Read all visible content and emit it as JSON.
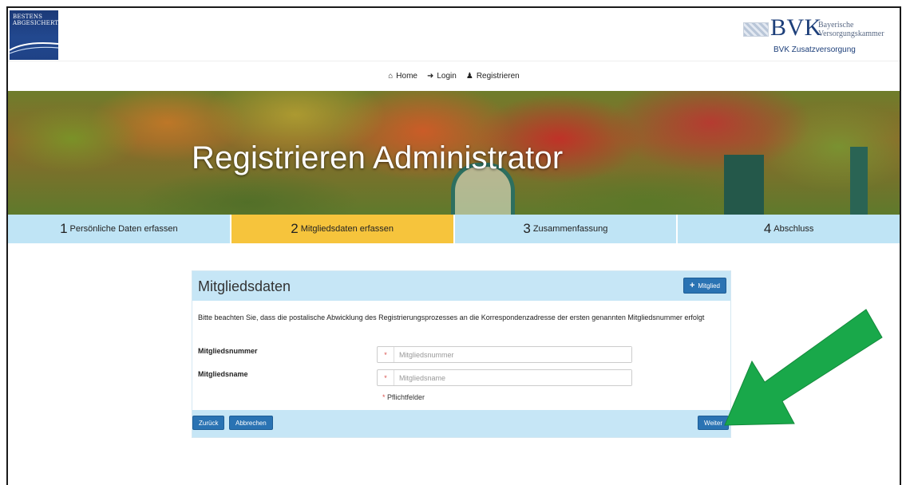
{
  "header": {
    "left_logo_text": [
      "BESTENS",
      "ABGESICHERT."
    ],
    "brand": "BVK",
    "brand_sub": [
      "Bayerische",
      "Versorgungskammer"
    ],
    "brand_tagline": "BVK Zusatzversorgung"
  },
  "nav": {
    "items": [
      {
        "icon": "home-icon",
        "label": "Home"
      },
      {
        "icon": "login-icon",
        "label": "Login"
      },
      {
        "icon": "user-plus-icon",
        "label": "Registrieren"
      }
    ]
  },
  "banner": {
    "title": "Registrieren Administrator"
  },
  "steps": [
    {
      "num": "1",
      "label": "Persönliche Daten erfassen"
    },
    {
      "num": "2",
      "label": "Mitgliedsdaten erfassen",
      "active": true
    },
    {
      "num": "3",
      "label": "Zusammenfassung"
    },
    {
      "num": "4",
      "label": "Abschluss"
    }
  ],
  "card": {
    "title": "Mitgliedsdaten",
    "add_button": "Mitglied",
    "note": "Bitte beachten Sie, dass die postalische Abwicklung des Registrierungsprozesses an die Korrespondenzadresse der ersten genannten Mitgliedsnummer erfolgt",
    "fields": [
      {
        "label": "Mitgliedsnummer",
        "placeholder": "Mitgliedsnummer",
        "value": "",
        "required_mark": "*"
      },
      {
        "label": "Mitgliedsname",
        "placeholder": "Mitgliedsname",
        "value": "",
        "required_mark": "*"
      }
    ],
    "required_note_star": "*",
    "required_note": "Pflichtfelder",
    "back_button": "Zurück",
    "cancel_button": "Abbrechen",
    "next_button": "Weiter"
  },
  "colors": {
    "step_inactive": "#bfe4f5",
    "step_active": "#f6c43c",
    "button": "#2a73b3",
    "card_header": "#c6e6f6",
    "arrow": "#19a84a"
  }
}
